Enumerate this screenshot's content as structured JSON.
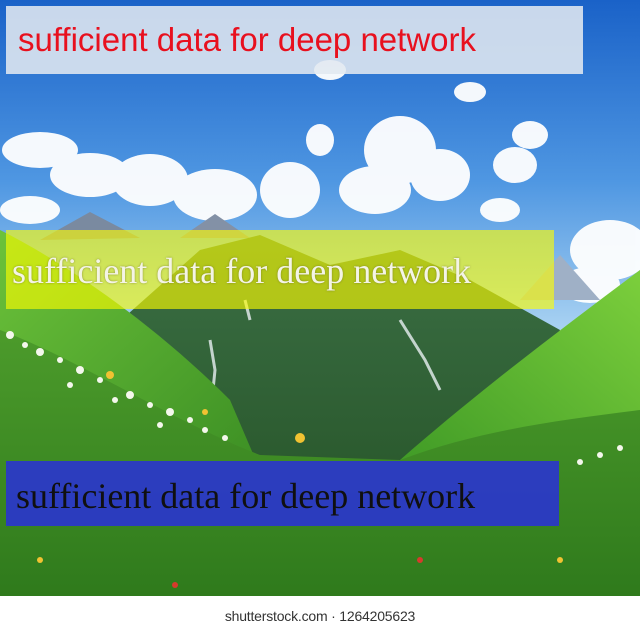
{
  "overlays": [
    {
      "text": "sufficient data for deep network",
      "text_color": "#e8101e",
      "box_color": "#e1e8f0"
    },
    {
      "text": "sufficient data for deep network",
      "text_color": "#f4f4e6",
      "box_color": "#ffff00"
    },
    {
      "text": "sufficient data for deep network",
      "text_color": "#101010",
      "box_color": "#2828eb"
    }
  ],
  "watermark": "shutterstock.com · 1264205623",
  "scene": {
    "description_icons": [
      "sky",
      "clouds",
      "snowy-peaks",
      "green-valley",
      "wildflowers"
    ],
    "colors": {
      "sky_top": "#1f6fd4",
      "sky_bottom": "#8ec3ef",
      "grass": "#4fa82a",
      "mountain": "#2f6a3a"
    }
  }
}
